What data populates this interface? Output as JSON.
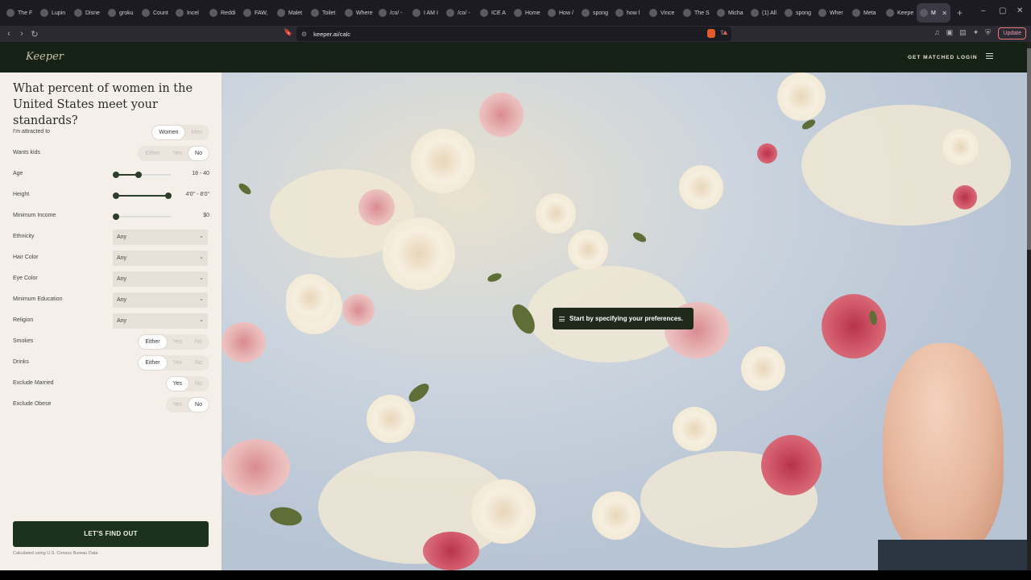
{
  "browser": {
    "tabs": [
      {
        "title": "The F"
      },
      {
        "title": "Lupin"
      },
      {
        "title": "Disne"
      },
      {
        "title": "groku"
      },
      {
        "title": "Count"
      },
      {
        "title": "Incel"
      },
      {
        "title": "Reddi"
      },
      {
        "title": "FAW,"
      },
      {
        "title": "Malet"
      },
      {
        "title": "Toilet"
      },
      {
        "title": "Where"
      },
      {
        "title": "/co/ -"
      },
      {
        "title": "I AM I"
      },
      {
        "title": "/co/ -"
      },
      {
        "title": "ICE A"
      },
      {
        "title": "Home"
      },
      {
        "title": "How /"
      },
      {
        "title": "spong"
      },
      {
        "title": "how l"
      },
      {
        "title": "Vince"
      },
      {
        "title": "The S"
      },
      {
        "title": "Micha"
      },
      {
        "title": "(1) All"
      },
      {
        "title": "spong"
      },
      {
        "title": "Wher"
      },
      {
        "title": "Meta"
      },
      {
        "title": "Keepe"
      },
      {
        "title": "M"
      }
    ],
    "url": "keeper.ai/calc",
    "update_label": "Update"
  },
  "site": {
    "logo": "Keeper",
    "nav": {
      "get_matched": "GET MATCHED",
      "login": "LOGIN"
    }
  },
  "calc": {
    "question": "What percent of women in the United States meet your standards?",
    "attracted": {
      "label": "I'm attracted to",
      "options": [
        "Women",
        "Men"
      ],
      "selected": "Women"
    },
    "wants_kids": {
      "label": "Wants kids",
      "options": [
        "Either",
        "Yes",
        "No"
      ],
      "selected": "No"
    },
    "age": {
      "label": "Age",
      "value": "18 - 40"
    },
    "height": {
      "label": "Height",
      "value": "4'0\" - 8'0\""
    },
    "income": {
      "label": "Minimum Income",
      "value": "$0"
    },
    "ethnicity": {
      "label": "Ethnicity",
      "value": "Any"
    },
    "hair": {
      "label": "Hair Color",
      "value": "Any"
    },
    "eye": {
      "label": "Eye Color",
      "value": "Any"
    },
    "education": {
      "label": "Minimum Education",
      "value": "Any"
    },
    "religion": {
      "label": "Religion",
      "value": "Any"
    },
    "smokes": {
      "label": "Smokes",
      "options": [
        "Either",
        "Yes",
        "No"
      ],
      "selected": "Either"
    },
    "drinks": {
      "label": "Drinks",
      "options": [
        "Either",
        "Yes",
        "No"
      ],
      "selected": "Either"
    },
    "married": {
      "label": "Exclude Married",
      "options": [
        "Yes",
        "No"
      ],
      "selected": "Yes"
    },
    "obese": {
      "label": "Exclude Obese",
      "options": [
        "Yes",
        "No"
      ],
      "selected": "No"
    },
    "cta": "LET'S FIND OUT",
    "footnote": "Calculated using U.S. Census Bureau Data"
  },
  "hero": {
    "toast": "Start by specifying your preferences."
  }
}
